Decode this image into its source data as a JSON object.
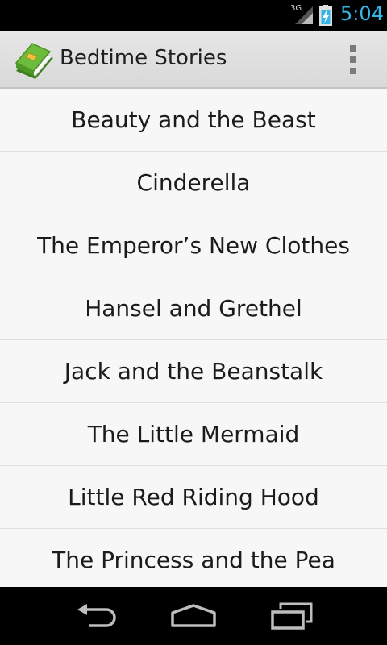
{
  "status_bar": {
    "network": "3G",
    "time": "5:04",
    "icons": [
      "signal-icon",
      "battery-charging-icon"
    ]
  },
  "action_bar": {
    "title": "Bedtime Stories",
    "icons": [
      "book-app-icon",
      "overflow-menu-icon"
    ]
  },
  "stories": [
    "Beauty and the Beast",
    "Cinderella",
    "The Emperor’s New Clothes",
    "Hansel and Grethel",
    "Jack and the Beanstalk",
    "The Little Mermaid",
    "Little Red Riding Hood",
    "The Princess and the Pea"
  ],
  "nav_bar": {
    "icons": [
      "back-icon",
      "home-icon",
      "recent-apps-icon"
    ]
  },
  "colors": {
    "clock": "#33b5e5",
    "action_bar": "#dedede",
    "list_background": "#f7f7f7",
    "book_green": "#6dbb3a"
  }
}
